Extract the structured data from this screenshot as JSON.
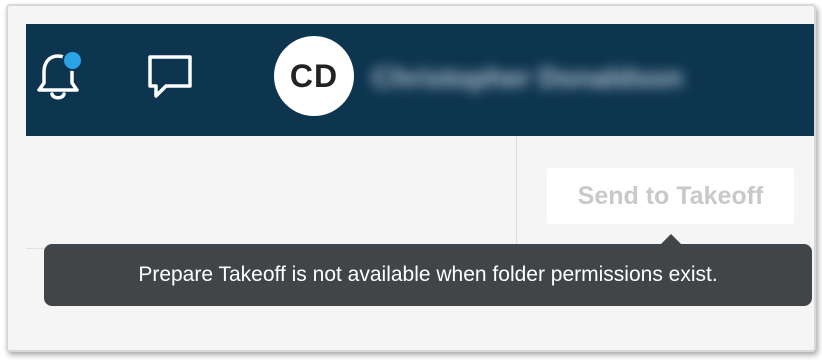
{
  "header": {
    "avatar_initials": "CD",
    "user_name": "Christopher Donaldson",
    "notification_badge_color": "#2aa3e6",
    "background_color": "#0e3550"
  },
  "toolbar": {
    "send_to_takeoff_label": "Send to Takeoff",
    "send_to_takeoff_state": "disabled"
  },
  "tooltip": {
    "text": "Prepare Takeoff is not available when folder permissions exist."
  },
  "icons": {
    "notifications": "bell-icon",
    "messages": "chat-bubble-icon"
  }
}
